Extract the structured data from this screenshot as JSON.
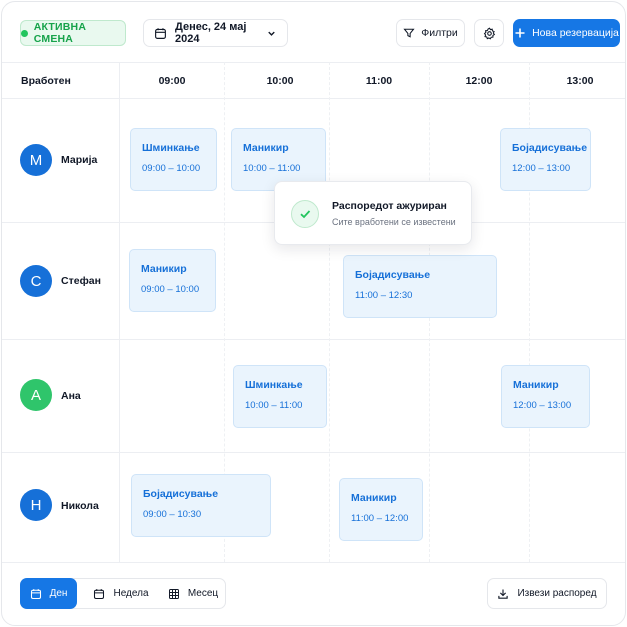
{
  "header": {
    "status_badge": "АКТИВНА СМЕНА",
    "date_label": "Денес, 24 мај 2024",
    "filter_label": "Филтри",
    "new_booking_label": "Нова резервација"
  },
  "schedule": {
    "employee_column_label": "Вработен",
    "time_columns": [
      "09:00",
      "10:00",
      "11:00",
      "12:00",
      "13:00"
    ],
    "employees": [
      {
        "initial": "М",
        "name": "Марија",
        "avatar_color": "#1670d8",
        "bookings": [
          {
            "service": "Шминкање",
            "time": "09:00 – 10:00"
          },
          {
            "service": "Маникир",
            "time": "10:00 – 11:00"
          },
          {
            "service": "Бојадисување",
            "time": "12:00 – 13:00"
          }
        ]
      },
      {
        "initial": "С",
        "name": "Стефан",
        "avatar_color": "#1670d8",
        "bookings": [
          {
            "service": "Маникир",
            "time": "09:00 – 10:00"
          },
          {
            "service": "Бојадисување",
            "time": "11:00 – 12:30"
          }
        ]
      },
      {
        "initial": "А",
        "name": "Ана",
        "avatar_color": "#2fc56b",
        "bookings": [
          {
            "service": "Шминкање",
            "time": "10:00 – 11:00"
          },
          {
            "service": "Маникир",
            "time": "12:00 – 13:00"
          }
        ]
      },
      {
        "initial": "Н",
        "name": "Никола",
        "avatar_color": "#1670d8",
        "bookings": [
          {
            "service": "Бојадисување",
            "time": "09:00 – 10:30"
          },
          {
            "service": "Маникир",
            "time": "11:00 – 12:00"
          }
        ]
      }
    ]
  },
  "toast": {
    "title": "Распоредот ажуриран",
    "subtitle": "Сите вработени се известени"
  },
  "footer": {
    "views": [
      {
        "label": "Ден",
        "active": true
      },
      {
        "label": "Недела",
        "active": false
      },
      {
        "label": "Месец",
        "active": false
      }
    ],
    "export_label": "Извези распоред"
  },
  "colors": {
    "accent": "#1677e5",
    "status_green": "#16a34a",
    "slot_bg": "#eaf4fd"
  }
}
